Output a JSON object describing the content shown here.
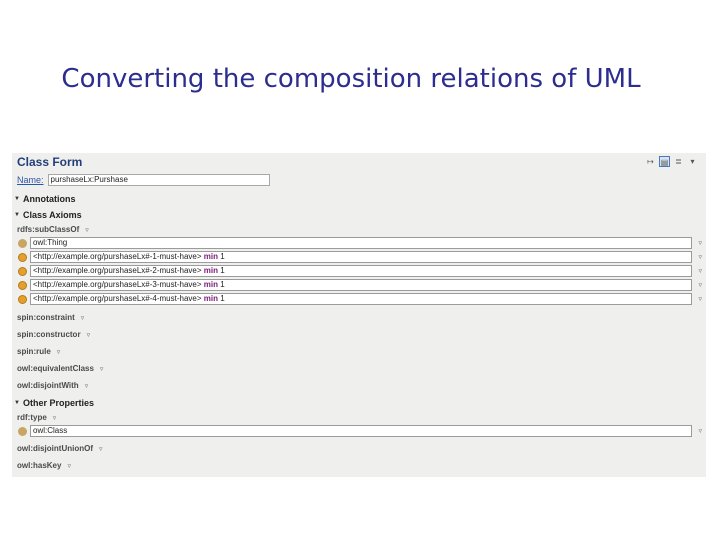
{
  "slide": {
    "title": "Converting the composition relations of UML"
  },
  "form": {
    "title": "Class Form",
    "name_label": "Name:",
    "name_value": "purshaseLx:Purshase",
    "sections": {
      "annotations": "Annotations",
      "class_axioms": "Class Axioms",
      "other_properties": "Other Properties"
    },
    "props": {
      "subclassof": "rdfs:subClassOf",
      "constraint": "spin:constraint",
      "constructor": "spin:constructor",
      "rule": "spin:rule",
      "equivalent": "owl:equivalentClass",
      "disjoint": "owl:disjointWith",
      "type": "rdf:type",
      "disjoint_union": "owl:disjointUnionOf",
      "haskey": "owl:hasKey"
    },
    "subclass_values": [
      {
        "prefix": "owl:Thing",
        "keyword": "",
        "suffix": ""
      },
      {
        "prefix": "<http://example.org/purshaseLx#-1-must-have>",
        "keyword": " min ",
        "suffix": "1"
      },
      {
        "prefix": "<http://example.org/purshaseLx#-2-must-have>",
        "keyword": " min ",
        "suffix": "1"
      },
      {
        "prefix": "<http://example.org/purshaseLx#-3-must-have>",
        "keyword": " min ",
        "suffix": "1"
      },
      {
        "prefix": "<http://example.org/purshaseLx#-4-must-have>",
        "keyword": " min ",
        "suffix": "1"
      }
    ],
    "type_value": "owl:Class",
    "dropdown_glyph": "▿",
    "colors": {
      "title": "#2c2d8f",
      "link": "#2b56a8",
      "keyword": "#7a1a7a",
      "panel": "#efefee"
    }
  }
}
